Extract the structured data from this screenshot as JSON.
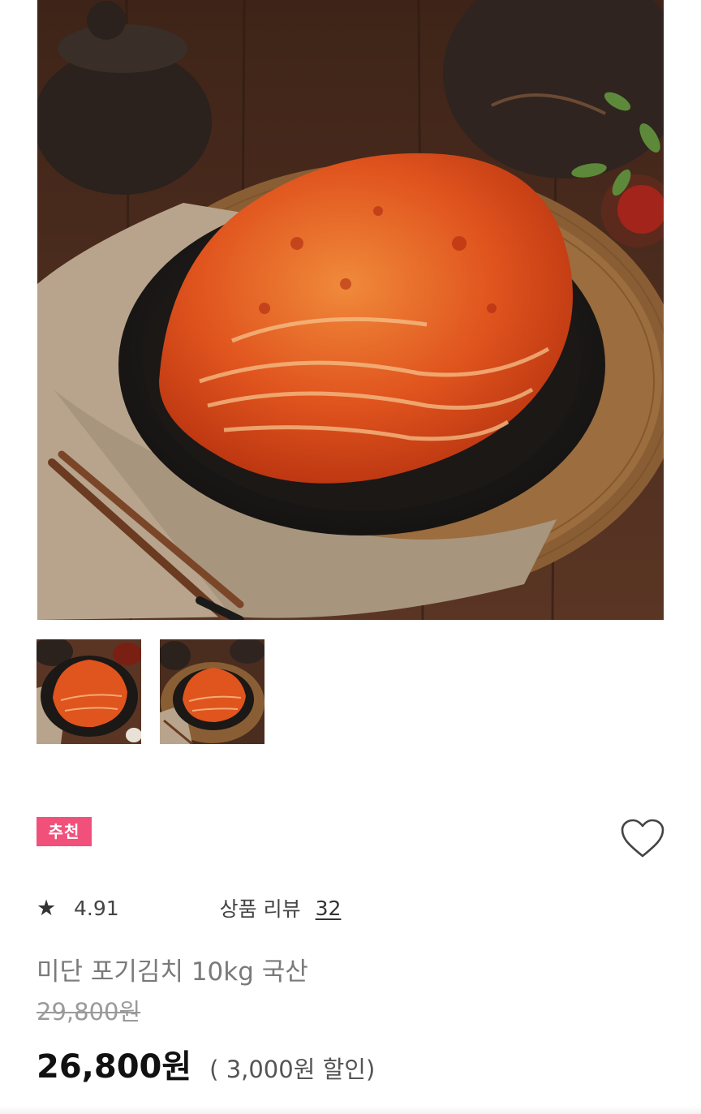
{
  "product": {
    "badge": "추천",
    "rating": "4.91",
    "review_label": "상품 리뷰",
    "review_count": "32",
    "title": "미단 포기김치 10kg 국산",
    "original_price": "29,800원",
    "sale_price": "26,800원",
    "discount_text": "( 3,000원 할인)"
  },
  "icons": {
    "star": "star-icon",
    "wishlist": "heart-icon"
  },
  "gallery": {
    "thumbnail_count": 2
  },
  "colors": {
    "badge": "#f0507a",
    "kimchi": "#e0541e",
    "table_wood": "#4a2d1e"
  }
}
